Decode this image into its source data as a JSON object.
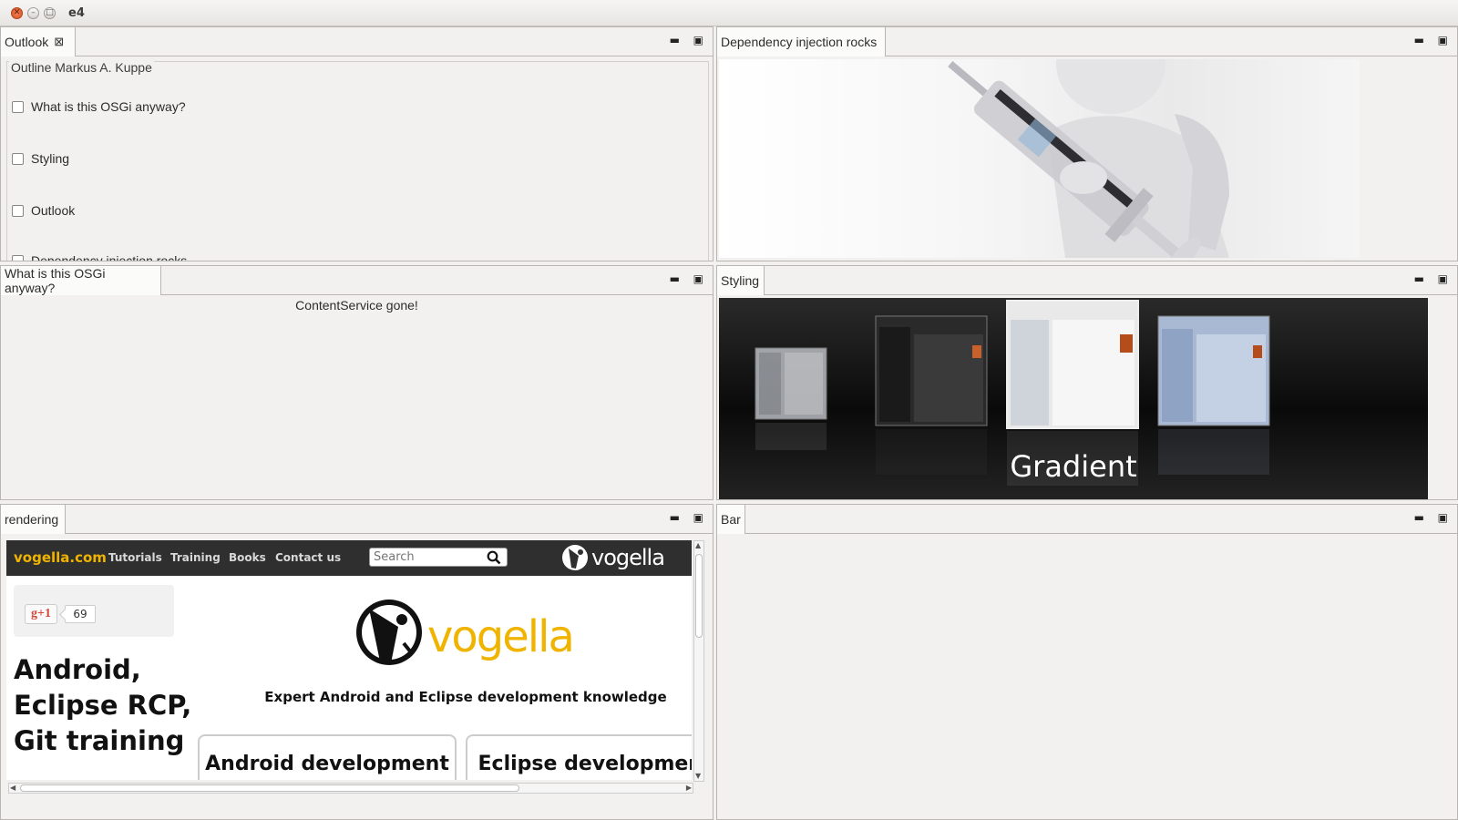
{
  "window": {
    "title": "e4"
  },
  "parts": {
    "outlook": {
      "tab_label": "Outlook",
      "group_label": "Outline Markus A. Kuppe",
      "items": [
        {
          "label": "What is this OSGi anyway?",
          "checked": false
        },
        {
          "label": "Styling",
          "checked": false
        },
        {
          "label": "Outlook",
          "checked": false
        },
        {
          "label": "Dependency injection rocks",
          "checked": false
        }
      ]
    },
    "di": {
      "tab_label": "Dependency injection rocks"
    },
    "osgi": {
      "tab_label": "What is this OSGi anyway?",
      "message": "ContentService gone!"
    },
    "styling": {
      "tab_label": "Styling",
      "carousel_caption": "Gradient"
    },
    "rendering": {
      "tab_label": "rendering",
      "site": {
        "brand": "vogella.com",
        "nav": [
          "Tutorials",
          "Training",
          "Books",
          "Contact us"
        ],
        "search_placeholder": "Search",
        "logo_text": "vogella",
        "gplus_label": "g+1",
        "gplus_count": "69",
        "headline": [
          "Android,",
          "Eclipse RCP,",
          "Git training"
        ],
        "tagline": "Expert Android and Eclipse development knowledge",
        "cards": [
          "Android development training",
          "Eclipse development training"
        ]
      }
    },
    "bar": {
      "tab_label": "Bar"
    }
  },
  "colors": {
    "brand_yellow": "#f0b400",
    "nav_dark": "#2f2f2f",
    "close_orange": "#e0561f"
  }
}
